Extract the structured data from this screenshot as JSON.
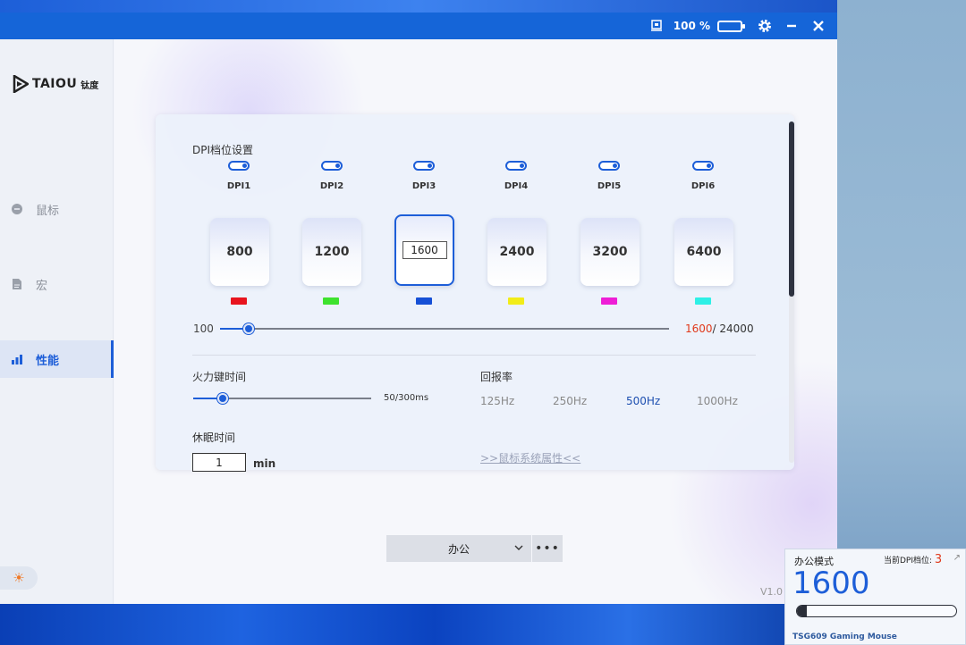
{
  "titlebar": {
    "battery_pct": "100 %",
    "icons": [
      "monitor-icon",
      "battery-icon",
      "gear-icon",
      "minimize-icon",
      "close-icon"
    ]
  },
  "brand": {
    "logo_text": "TAIOU",
    "logo_cn": "钛度"
  },
  "sidebar": {
    "items": [
      {
        "label": "鼠标",
        "icon": "mouse-icon",
        "active": false
      },
      {
        "label": "宏",
        "icon": "file-icon",
        "active": false
      },
      {
        "label": "性能",
        "icon": "bar-chart-icon",
        "active": true
      }
    ],
    "theme_icon": "sun-icon"
  },
  "dpi": {
    "section_title": "DPI档位设置",
    "slots": [
      {
        "label": "DPI1",
        "value": "800",
        "color": "#e8141e",
        "enabled": true
      },
      {
        "label": "DPI2",
        "value": "1200",
        "color": "#3ee22e",
        "enabled": true
      },
      {
        "label": "DPI3",
        "value": "1600",
        "color": "#1650d6",
        "enabled": true,
        "selected": true
      },
      {
        "label": "DPI4",
        "value": "2400",
        "color": "#f2ec18",
        "enabled": true
      },
      {
        "label": "DPI5",
        "value": "3200",
        "color": "#ee1ed6",
        "enabled": true
      },
      {
        "label": "DPI6",
        "value": "6400",
        "color": "#2ef0e6",
        "enabled": true
      }
    ],
    "slider_min": "100",
    "slider_current": "1600",
    "slider_max": "/ 24000",
    "slider_fraction": 0.063
  },
  "fire_key": {
    "title": "火力键时间",
    "value": "50/300ms",
    "slider_fraction": 0.166
  },
  "polling": {
    "title": "回报率",
    "options": [
      "125Hz",
      "250Hz",
      "500Hz",
      "1000Hz"
    ],
    "selected": "500Hz"
  },
  "sleep": {
    "title": "休眠时间",
    "value": "1",
    "unit": "min"
  },
  "link_text": ">>鼠标系统属性<<",
  "mode_select": {
    "value": "办公",
    "more": "•••"
  },
  "version": "V1.0 I",
  "widget": {
    "mode": "办公模式",
    "current_label": "当前DPI档位:",
    "current_slot": "3",
    "dpi": "1600",
    "bar_fraction": 0.06,
    "device": "TSG609 Gaming Mouse"
  }
}
